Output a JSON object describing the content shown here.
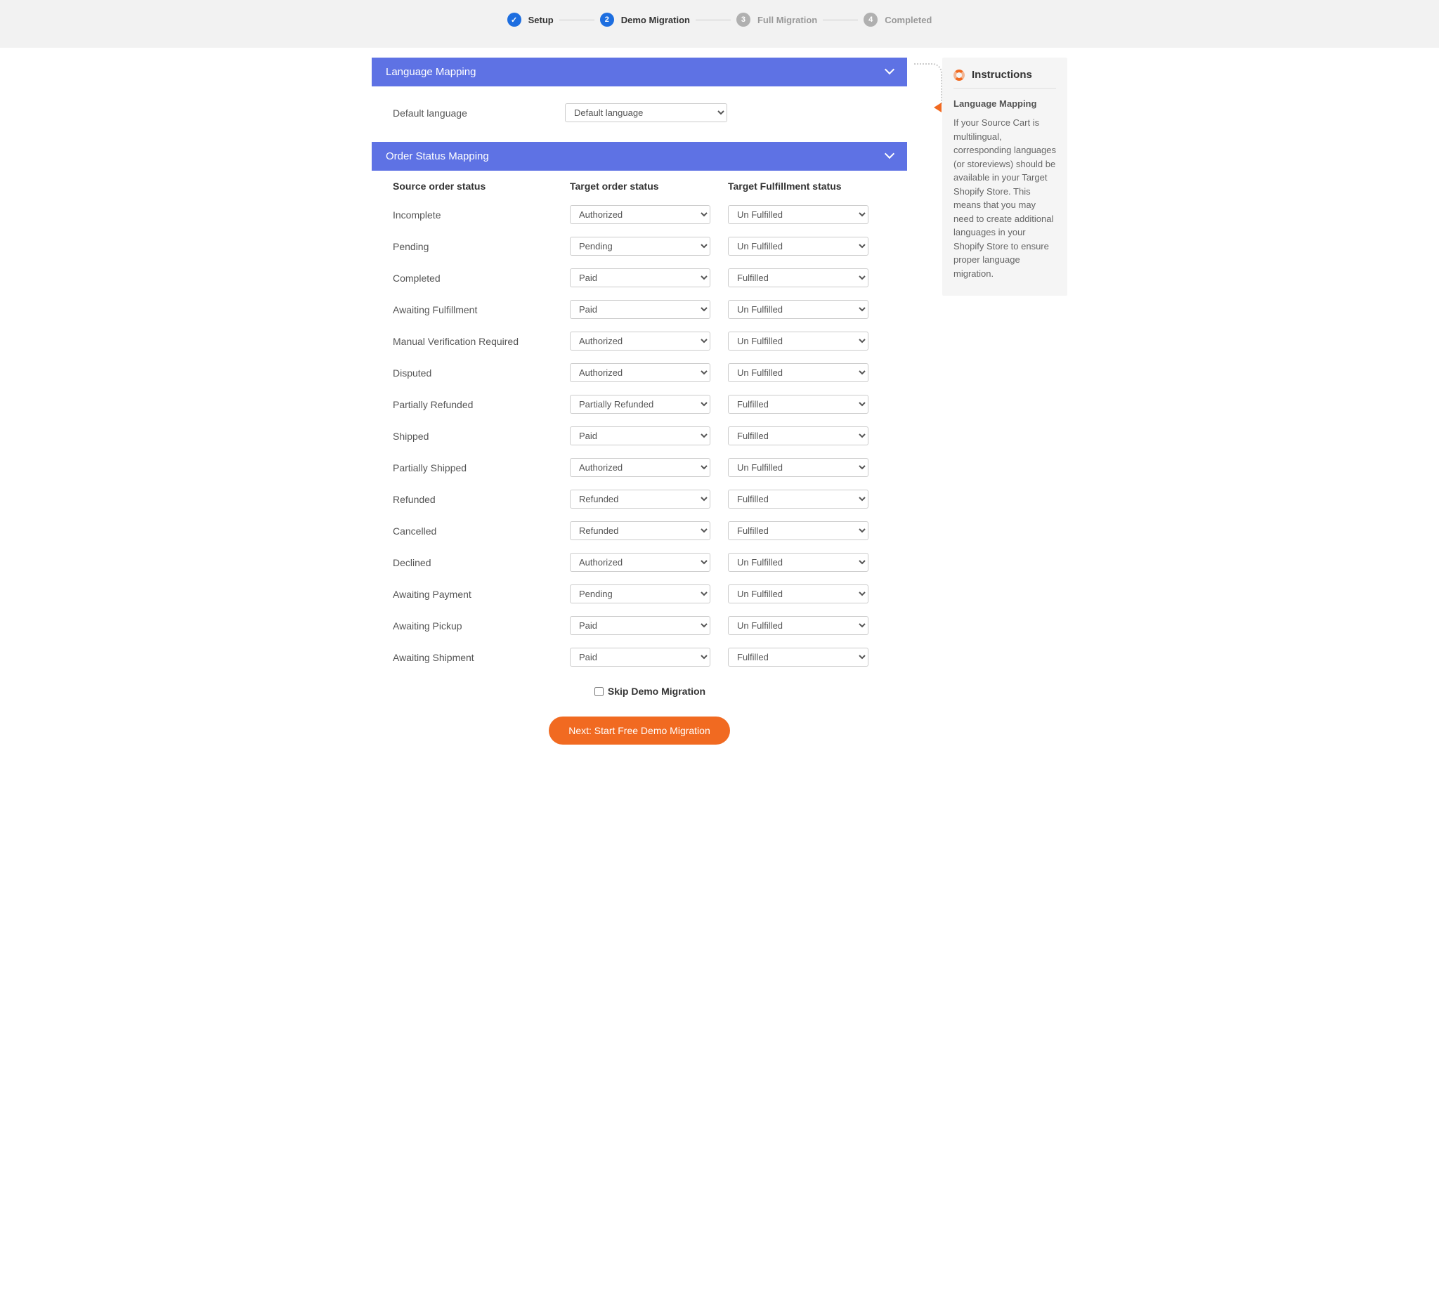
{
  "stepper": {
    "steps": [
      {
        "num": "✓",
        "label": "Setup",
        "state": "done"
      },
      {
        "num": "2",
        "label": "Demo Migration",
        "state": "active"
      },
      {
        "num": "3",
        "label": "Full Migration",
        "state": "pending"
      },
      {
        "num": "4",
        "label": "Completed",
        "state": "pending"
      }
    ]
  },
  "language_panel": {
    "title": "Language Mapping",
    "default_lang_label": "Default language",
    "default_lang_value": "Default language"
  },
  "order_panel": {
    "title": "Order Status Mapping",
    "headers": {
      "source": "Source order status",
      "target": "Target order status",
      "fulfill": "Target Fulfillment status"
    },
    "rows": [
      {
        "source": "Incomplete",
        "target": "Authorized",
        "fulfill": "Un Fulfilled"
      },
      {
        "source": "Pending",
        "target": "Pending",
        "fulfill": "Un Fulfilled"
      },
      {
        "source": "Completed",
        "target": "Paid",
        "fulfill": "Fulfilled"
      },
      {
        "source": "Awaiting Fulfillment",
        "target": "Paid",
        "fulfill": "Un Fulfilled"
      },
      {
        "source": "Manual Verification Required",
        "target": "Authorized",
        "fulfill": "Un Fulfilled"
      },
      {
        "source": "Disputed",
        "target": "Authorized",
        "fulfill": "Un Fulfilled"
      },
      {
        "source": "Partially Refunded",
        "target": "Partially Refunded",
        "fulfill": "Fulfilled"
      },
      {
        "source": "Shipped",
        "target": "Paid",
        "fulfill": "Fulfilled"
      },
      {
        "source": "Partially Shipped",
        "target": "Authorized",
        "fulfill": "Un Fulfilled"
      },
      {
        "source": "Refunded",
        "target": "Refunded",
        "fulfill": "Fulfilled"
      },
      {
        "source": "Cancelled",
        "target": "Refunded",
        "fulfill": "Fulfilled"
      },
      {
        "source": "Declined",
        "target": "Authorized",
        "fulfill": "Un Fulfilled"
      },
      {
        "source": "Awaiting Payment",
        "target": "Pending",
        "fulfill": "Un Fulfilled"
      },
      {
        "source": "Awaiting Pickup",
        "target": "Paid",
        "fulfill": "Un Fulfilled"
      },
      {
        "source": "Awaiting Shipment",
        "target": "Paid",
        "fulfill": "Fulfilled"
      }
    ]
  },
  "skip_label": "Skip Demo Migration",
  "next_button": "Next: Start Free Demo Migration",
  "instructions": {
    "title": "Instructions",
    "subtitle": "Language Mapping",
    "body": "If your Source Cart is multilingual, corresponding languages (or storeviews) should be available in your Target Shopify Store. This means that you may need to create additional languages in your Shopify Store to ensure proper language migration."
  }
}
